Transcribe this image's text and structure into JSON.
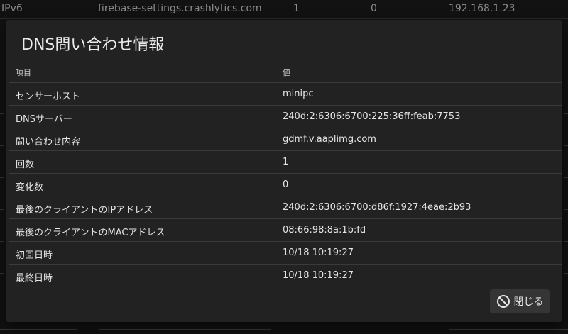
{
  "background_table": {
    "row": {
      "protocol": "IPv6",
      "domain": "firebase-settings.crashlytics.com",
      "count": "1",
      "changes": "0",
      "client_ip": "192.168.1.23"
    }
  },
  "dialog": {
    "title": "DNS問い合わせ情報",
    "headers": {
      "key": "項目",
      "value": "値"
    },
    "rows": [
      {
        "key": "センサーホスト",
        "value": "minipc"
      },
      {
        "key": "DNSサーバー",
        "value": "240d:2:6306:6700:225:36ff:feab:7753"
      },
      {
        "key": "問い合わせ内容",
        "value": "gdmf.v.aaplimg.com"
      },
      {
        "key": "回数",
        "value": "1"
      },
      {
        "key": "変化数",
        "value": "0"
      },
      {
        "key": "最後のクライアントのIPアドレス",
        "value": "240d:2:6306:6700:d86f:1927:4eae:2b93"
      },
      {
        "key": "最後のクライアントのMACアドレス",
        "value": "08:66:98:8a:1b:fd"
      },
      {
        "key": "初回日時",
        "value": "10/18 10:19:27"
      },
      {
        "key": "最終日時",
        "value": "10/18 10:19:27"
      }
    ],
    "close_button": {
      "label": "閉じる",
      "icon": "block-icon"
    }
  }
}
